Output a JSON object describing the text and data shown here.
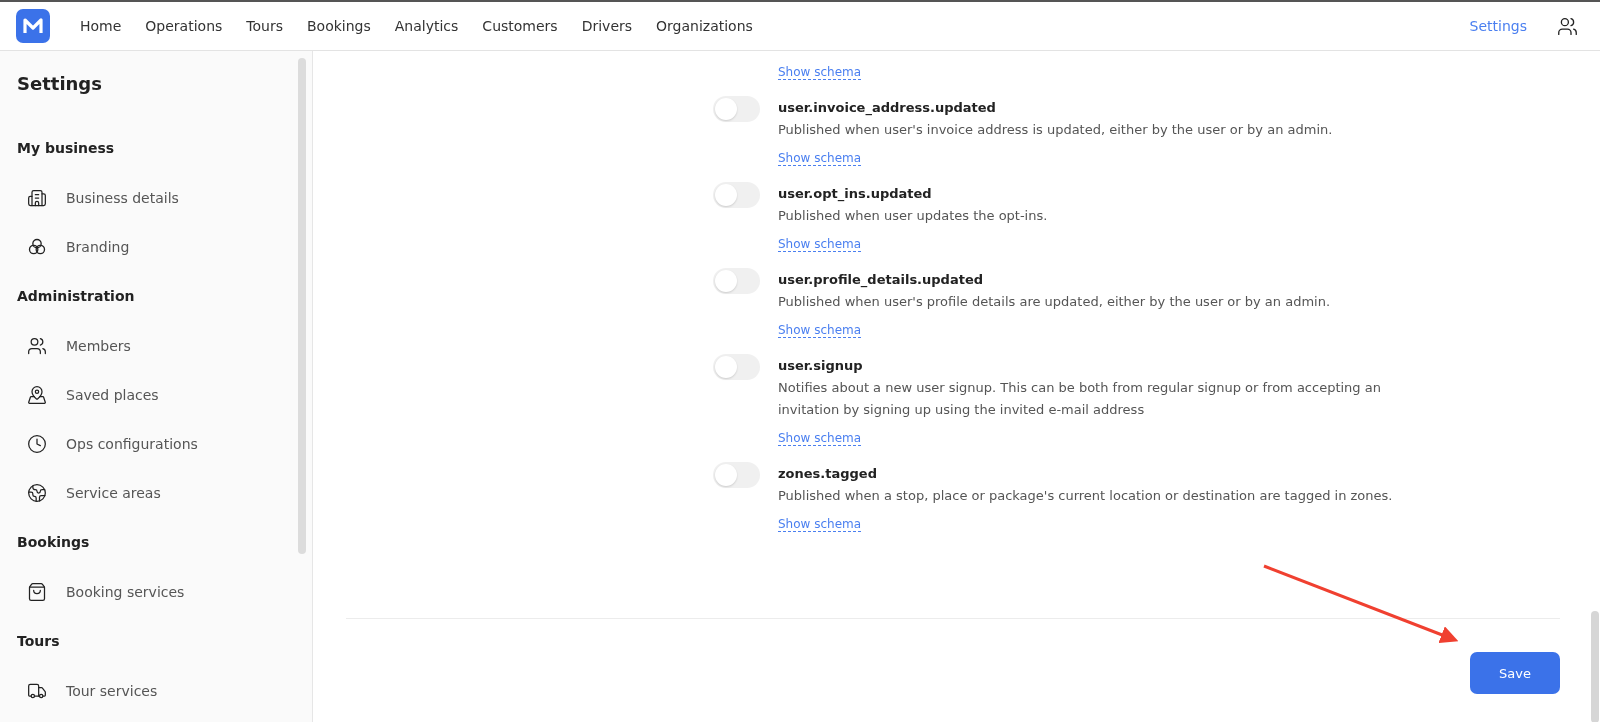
{
  "nav": {
    "items": [
      {
        "label": "Home",
        "selected": false
      },
      {
        "label": "Operations",
        "selected": false
      },
      {
        "label": "Tours",
        "selected": false
      },
      {
        "label": "Bookings",
        "selected": false
      },
      {
        "label": "Analytics",
        "selected": false
      },
      {
        "label": "Customers",
        "selected": false
      },
      {
        "label": "Drivers",
        "selected": false
      },
      {
        "label": "Organizations",
        "selected": false
      }
    ],
    "settings": {
      "label": "Settings",
      "selected": true
    }
  },
  "sidebar": {
    "title": "Settings",
    "sections": [
      {
        "heading": "My business",
        "items": [
          {
            "label": "Business details",
            "kind": "building"
          },
          {
            "label": "Branding",
            "kind": "circles"
          }
        ]
      },
      {
        "heading": "Administration",
        "items": [
          {
            "label": "Members",
            "kind": "users"
          },
          {
            "label": "Saved places",
            "kind": "pin"
          },
          {
            "label": "Ops configurations",
            "kind": "clock"
          },
          {
            "label": "Service areas",
            "kind": "globe"
          }
        ]
      },
      {
        "heading": "Bookings",
        "items": [
          {
            "label": "Booking services",
            "kind": "bag"
          }
        ]
      },
      {
        "heading": "Tours",
        "items": [
          {
            "label": "Tour services",
            "kind": "truck"
          }
        ]
      }
    ]
  },
  "clipped_schema_link": "Show schema",
  "events": [
    {
      "name": "user.invoice_address.updated",
      "description": "Published when user's invoice address is updated, either by the user or by an admin.",
      "on": false,
      "link": "Show schema"
    },
    {
      "name": "user.opt_ins.updated",
      "description": "Published when user updates the opt-ins.",
      "on": false,
      "link": "Show schema"
    },
    {
      "name": "user.profile_details.updated",
      "description": "Published when user's profile details are updated, either by the user or by an admin.",
      "on": false,
      "link": "Show schema"
    },
    {
      "name": "user.signup",
      "description": "Notifies about a new user signup. This can be both from regular signup or from accepting an invitation by signing up using the invited e-mail address",
      "on": false,
      "link": "Show schema"
    },
    {
      "name": "zones.tagged",
      "description": "Published when a stop, place or package's current location or destination are tagged in zones.",
      "on": false,
      "link": "Show schema"
    }
  ],
  "save_button": "Save"
}
